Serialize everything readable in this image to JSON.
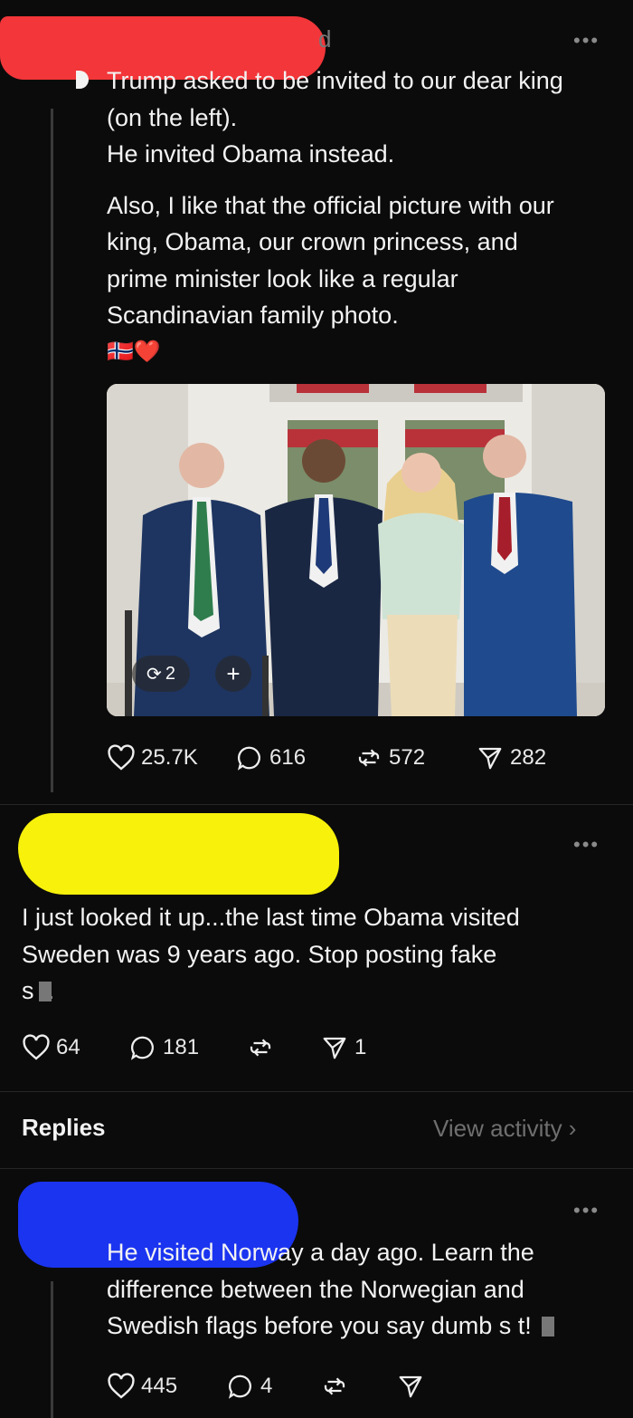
{
  "post": {
    "author_suffix": "d",
    "more_label": "•••",
    "text_para1": [
      "Trump asked to be invited to our dear king",
      "(on the left).",
      "He invited Obama instead."
    ],
    "text_para2": [
      "Also, I like that the official picture with our",
      "king, Obama, our crown princess, and",
      "prime minister look like a regular",
      "Scandinavian family photo."
    ],
    "emoji": "🇳🇴❤️",
    "image_overlay": {
      "repost_count": "2",
      "add_label": "+"
    },
    "stats": {
      "likes": "25.7K",
      "comments": "616",
      "reposts": "572",
      "shares": "282"
    }
  },
  "comment": {
    "more_label": "•••",
    "text": [
      "I just looked it up...the last time Obama visited",
      "Sweden was 9 years ago. Stop posting fake",
      "s  t."
    ],
    "stats": {
      "likes": "64",
      "comments": "181",
      "shares": "1"
    }
  },
  "replies_header": {
    "title": "Replies",
    "link": "View activity ›"
  },
  "reply": {
    "more_label": "•••",
    "text": [
      "He visited Norway a day ago. Learn the",
      "difference between the Norwegian and",
      "Swedish flags before you say dumb s  t!"
    ],
    "stats": {
      "likes": "445",
      "comments": "4"
    }
  },
  "colors": {
    "redaction_red": "#f2363a",
    "redaction_yellow": "#f7f10b",
    "redaction_blue": "#1b34f0",
    "background": "#0b0b0b"
  }
}
